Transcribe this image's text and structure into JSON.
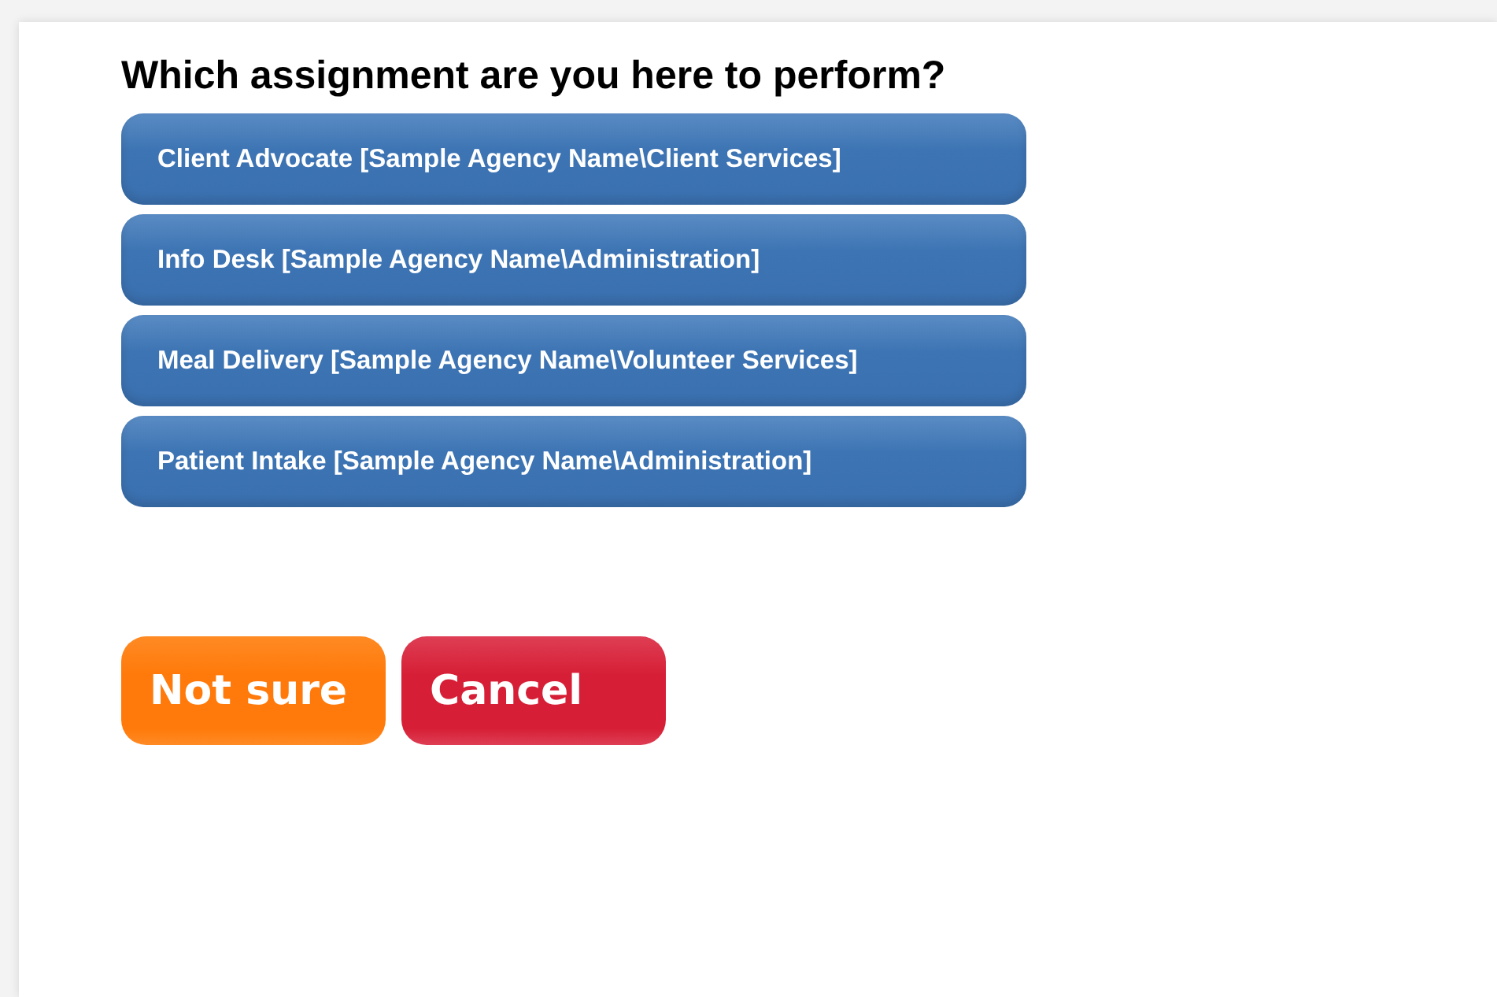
{
  "heading": "Which assignment are you here to perform?",
  "assignments": [
    "Client Advocate [Sample Agency Name\\Client Services]",
    "Info Desk [Sample Agency Name\\Administration]",
    "Meal Delivery [Sample Agency Name\\Volunteer Services]",
    "Patient Intake [Sample Agency Name\\Administration]"
  ],
  "actions": [
    {
      "label": "Not sure",
      "kind": "neutral"
    },
    {
      "label": "Cancel",
      "kind": "cancel"
    }
  ]
}
